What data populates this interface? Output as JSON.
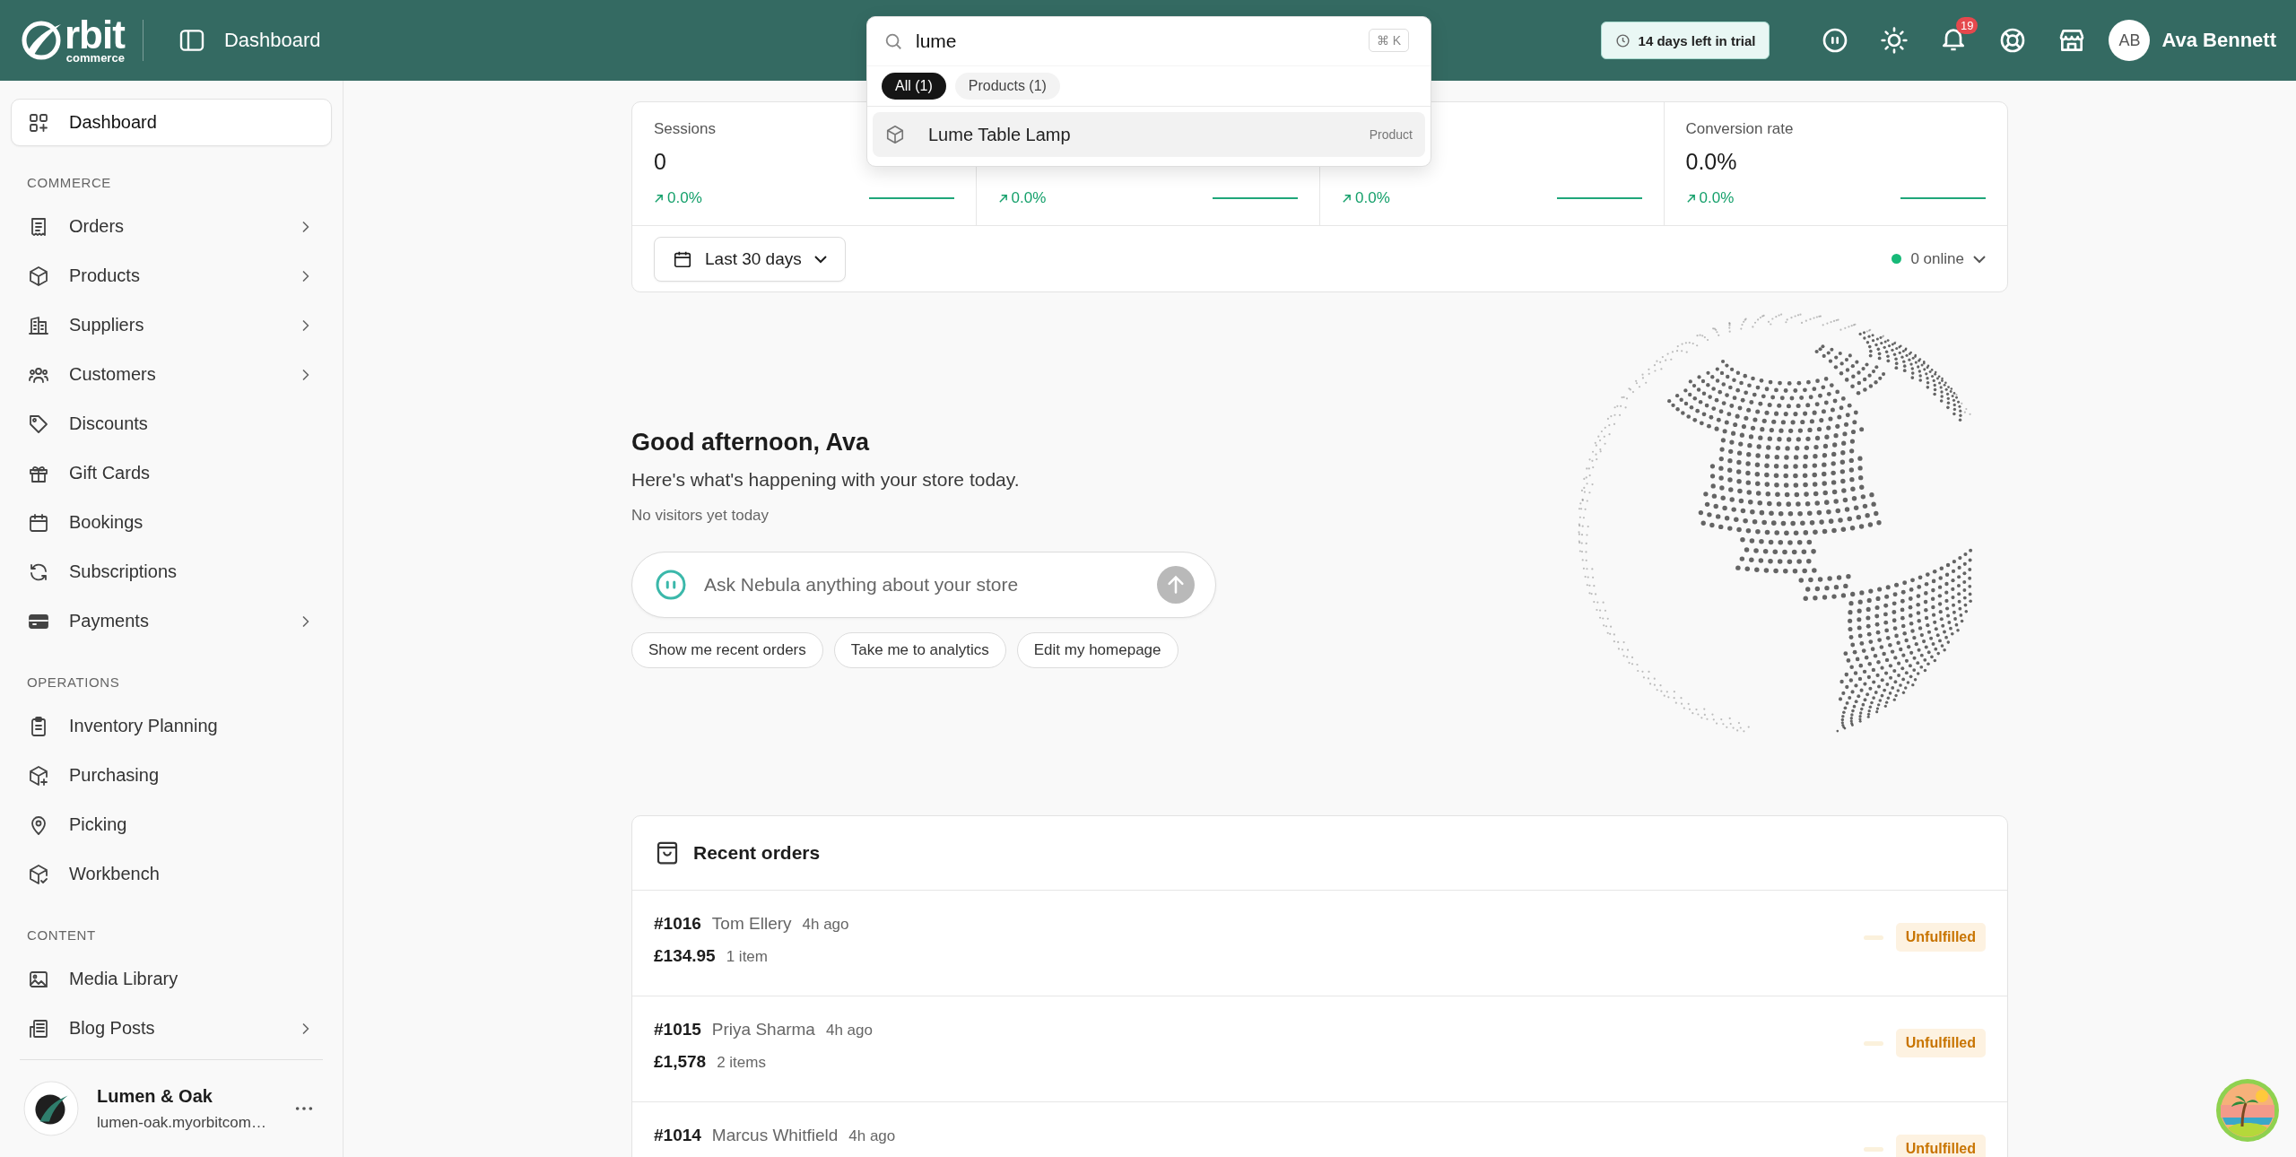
{
  "topbar": {
    "logo": {
      "wordmark": "rbit",
      "tagline": "commerce"
    },
    "page_title": "Dashboard",
    "trial": "14 days left in trial",
    "notifications": "19",
    "user": {
      "initials": "AB",
      "name": "Ava Bennett"
    }
  },
  "search": {
    "value": "lume",
    "shortcut": "⌘ K",
    "filters": [
      {
        "label": "All (1)",
        "selected": true
      },
      {
        "label": "Products (1)",
        "selected": false
      }
    ],
    "results": [
      {
        "title": "Lume Table Lamp",
        "type": "Product",
        "highlighted": true
      }
    ]
  },
  "sidebar": {
    "sections": [
      {
        "items": [
          {
            "label": "Dashboard",
            "selected": true,
            "expandable": false
          }
        ]
      },
      {
        "heading": "COMMERCE",
        "items": [
          {
            "label": "Orders",
            "selected": false,
            "expandable": true
          },
          {
            "label": "Products",
            "selected": false,
            "expandable": true
          },
          {
            "label": "Suppliers",
            "selected": false,
            "expandable": true
          },
          {
            "label": "Customers",
            "selected": false,
            "expandable": true
          },
          {
            "label": "Discounts",
            "selected": false,
            "expandable": false
          },
          {
            "label": "Gift Cards",
            "selected": false,
            "expandable": false
          },
          {
            "label": "Bookings",
            "selected": false,
            "expandable": false
          },
          {
            "label": "Subscriptions",
            "selected": false,
            "expandable": false
          },
          {
            "label": "Payments",
            "selected": false,
            "expandable": true
          }
        ]
      },
      {
        "heading": "OPERATIONS",
        "items": [
          {
            "label": "Inventory Planning",
            "selected": false,
            "expandable": false
          },
          {
            "label": "Purchasing",
            "selected": false,
            "expandable": false
          },
          {
            "label": "Picking",
            "selected": false,
            "expandable": false
          },
          {
            "label": "Workbench",
            "selected": false,
            "expandable": false
          }
        ]
      },
      {
        "heading": "CONTENT",
        "items": [
          {
            "label": "Media Library",
            "selected": false,
            "expandable": false
          },
          {
            "label": "Blog Posts",
            "selected": false,
            "expandable": true
          }
        ]
      }
    ],
    "store": {
      "name": "Lumen & Oak",
      "domain": "lumen-oak.myorbitcom…"
    }
  },
  "stats": [
    {
      "label": "Sessions",
      "value": "0",
      "change": "0.0%"
    },
    {
      "change": "0.0%"
    },
    {
      "change": "0.0%"
    },
    {
      "label": "Conversion rate",
      "value": "0.0%",
      "change": "0.0%"
    }
  ],
  "date_range": "Last 30 days",
  "online": "0 online",
  "greeting": {
    "title": "Good afternoon, Ava",
    "subtitle": "Here's what's happening with your store today.",
    "note": "No visitors yet today"
  },
  "assistant": {
    "placeholder": "Ask Nebula anything about your store",
    "suggestions": [
      "Show me recent orders",
      "Take me to analytics",
      "Edit my homepage"
    ]
  },
  "recent_orders": {
    "title": "Recent orders",
    "orders": [
      {
        "number": "#1016",
        "customer": "Tom Ellery",
        "time": "4h ago",
        "total": "£134.95",
        "items": "1 item",
        "status": "Unfulfilled"
      },
      {
        "number": "#1015",
        "customer": "Priya Sharma",
        "time": "4h ago",
        "total": "£1,578",
        "items": "2 items",
        "status": "Unfulfilled"
      },
      {
        "number": "#1014",
        "customer": "Marcus Whitfield",
        "time": "4h ago",
        "status": "Unfulfilled"
      }
    ]
  }
}
